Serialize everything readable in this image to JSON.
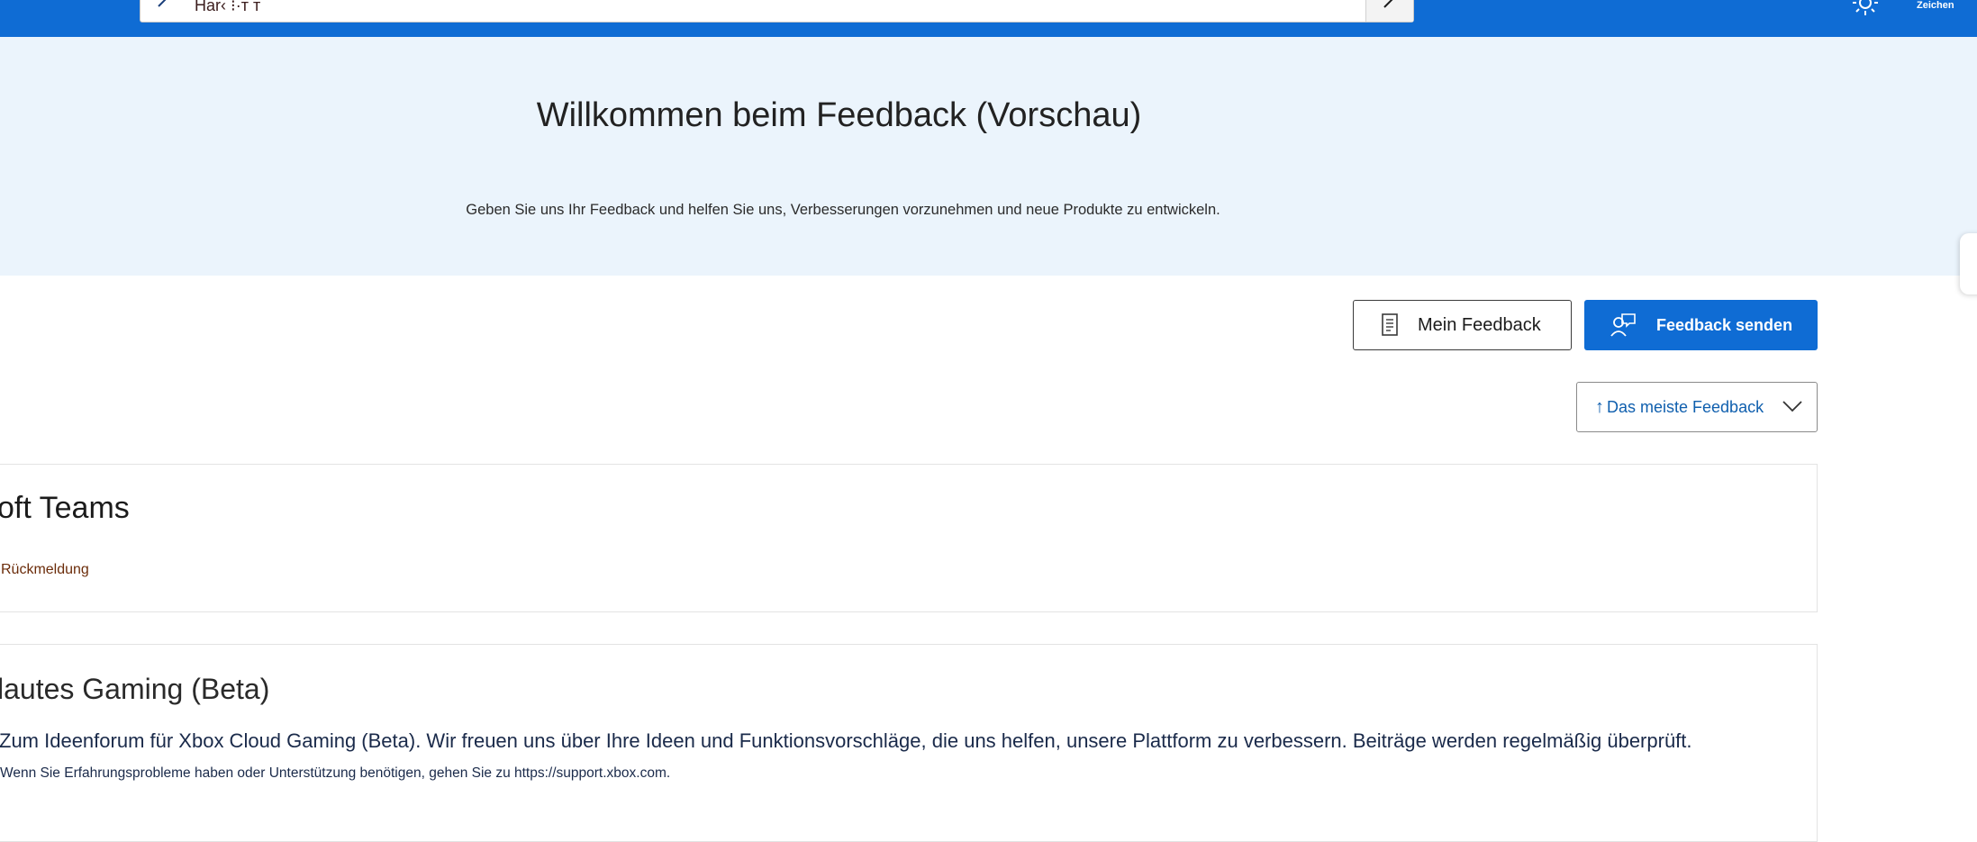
{
  "topbar": {
    "search_value": "Har‹ ⁝·ᴛ ᴛ",
    "signin_label": "Zeichen"
  },
  "hero": {
    "title": "Willkommen beim Feedback (Vorschau)",
    "subtitle": "Geben Sie uns Ihr Feedback und helfen Sie uns, Verbesserungen vorzunehmen und neue Produkte zu entwickeln."
  },
  "actions": {
    "my_feedback_label": "Mein Feedback",
    "send_feedback_label": "Feedback senden"
  },
  "sort": {
    "arrow": "↑",
    "selected": "Das meiste Feedback"
  },
  "cards": [
    {
      "title": "oft Teams",
      "meta": "Rückmeldung"
    },
    {
      "title": "lautes Gaming (Beta)",
      "description": "Zum Ideenforum für Xbox Cloud Gaming (Beta). Wir freuen uns über Ihre Ideen und Funktionsvorschläge, die uns helfen, unsere Plattform zu verbessern. Beiträge werden regelmäßig überprüft.",
      "note": "Wenn Sie Erfahrungsprobleme haben oder Unterstützung benötigen, gehen Sie zu https://support.xbox.com."
    }
  ],
  "colors": {
    "brand_blue": "#0f6cd4",
    "hero_background": "#ebf4fc",
    "link_blue": "#0f5fae"
  },
  "icons": [
    "search-icon",
    "arrow-icon",
    "brightness-icon",
    "document-icon",
    "feedback-person-icon",
    "chevron-down-icon"
  ]
}
